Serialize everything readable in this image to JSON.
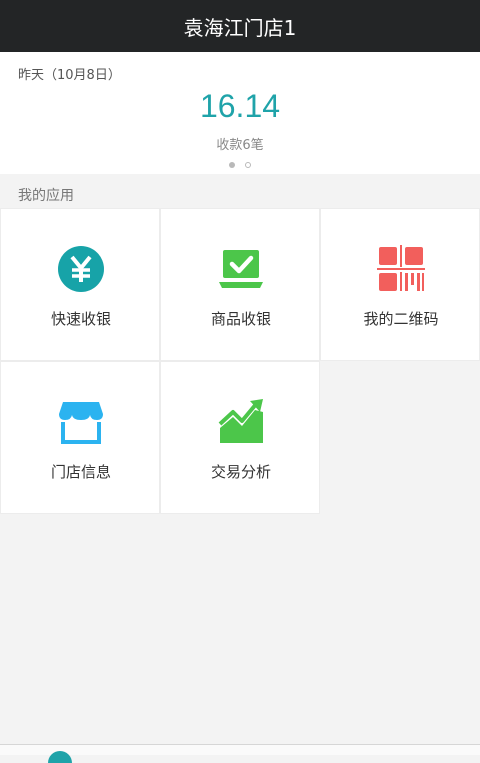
{
  "header": {
    "title": "袁海江门店1"
  },
  "summary": {
    "date": "昨天（10月8日）",
    "amount": "16.14",
    "count_label": "收款6笔"
  },
  "apps": {
    "section_title": "我的应用",
    "items": [
      {
        "label": "快速收银",
        "icon": "yuan-coin-icon",
        "color": "#17a3a8"
      },
      {
        "label": "商品收银",
        "icon": "laptop-check-icon",
        "color": "#4cc64a"
      },
      {
        "label": "我的二维码",
        "icon": "qr-code-icon",
        "color": "#f25f5c"
      },
      {
        "label": "门店信息",
        "icon": "storefront-icon",
        "color": "#2bb3f0"
      },
      {
        "label": "交易分析",
        "icon": "trend-chart-icon",
        "color": "#4cc64a"
      }
    ]
  },
  "colors": {
    "accent": "#1fa3a9",
    "header_bg": "#232526",
    "page_bg": "#f3f3f3"
  }
}
